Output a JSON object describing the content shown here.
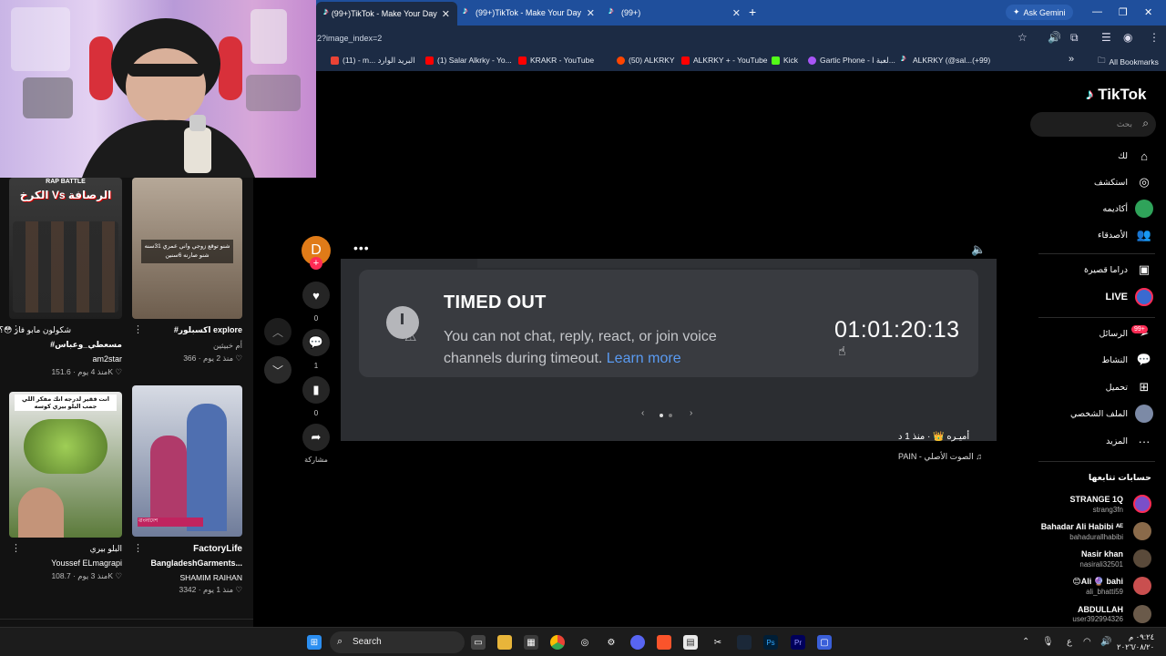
{
  "browser": {
    "tabs": [
      {
        "label": "(99+)TikTok - Make Your Day"
      },
      {
        "label": "(99+)TikTok - Make Your Day"
      },
      {
        "label": "(99+)"
      }
    ],
    "new_tab": "+",
    "ask_gemini": "Ask Gemini",
    "url": "2?image_index=2",
    "bookmarks": [
      {
        "label": "(11) - m... البريد الوارد",
        "color": "#ea4335"
      },
      {
        "label": "(1) Salar Alkrky - Yo...",
        "color": "#ff0000"
      },
      {
        "label": "KRAKR - YouTube",
        "color": "#ff0000"
      },
      {
        "label": "(50) ALKRKY",
        "color": "#ff4500"
      },
      {
        "label": "ALKRKY + - YouTube",
        "color": "#ff0000"
      },
      {
        "label": "Kick",
        "color": "#53fc18"
      },
      {
        "label": "Gartic Phone - لعبة ا...",
        "color": "#a855f7"
      },
      {
        "label": "ALKRKY (@sal...(+99)",
        "color": "#000000"
      }
    ],
    "all_bookmarks": "All Bookmarks"
  },
  "feed": {
    "items": [
      {
        "overlay": "RAP BATTLE",
        "overlay2": "الكرخ Vs الرصافة",
        "caption": "شكولون مابو فاز 😳؟",
        "caption2": "#مسعطي_وعباس",
        "author": "am2star",
        "meta": "منذ 4 يوم · 151.6K ♡"
      },
      {
        "overlay": "شنو توقع زوجي واني عمري 31سنه شنو صارنه 6سنين",
        "caption": "#اكسبلور explore",
        "author": "أم خبيثين",
        "meta": "منذ 2 يوم · 366 ♡"
      },
      {
        "overlay": "انت فقير لدرجه انك مفكر اللي جمب البلو بيري كوسه",
        "caption": "البلو بيري",
        "author": "Youssef ELmagrapi",
        "meta": "منذ 3 يوم · 108.7K ♡"
      },
      {
        "overlay": "বাংলাদেশ",
        "caption": "FactoryLife",
        "caption2": "BangladeshGarments...",
        "author": "SHAMIM RAIHAN",
        "meta": "منذ 1 يوم · 3342 ♡"
      }
    ]
  },
  "player": {
    "avatar_letter": "D",
    "like_count": "0",
    "comment_count": "1",
    "save_count": "0",
    "share_label": "مشاركة",
    "timeout_title": "TIMED OUT",
    "timeout_body": "You can not chat, reply, react, or join voice channels during timeout.",
    "learn_more": "Learn more",
    "timer": "01:01:20:13",
    "author_line": "أميـره 👑 · منذ 1 د",
    "music_line": "PAIN - الصوت الأصلي ♫"
  },
  "sidebar": {
    "logo": "TikTok",
    "search_placeholder": "بحث",
    "nav": [
      {
        "label": "لك",
        "icon": "home-icon"
      },
      {
        "label": "استكشف",
        "icon": "compass-icon"
      },
      {
        "label": "أكاديمه",
        "icon": "avatar-icon"
      },
      {
        "label": "الأصدقاء",
        "icon": "friends-icon"
      },
      {
        "label": "دراما قصيرة",
        "icon": "drama-icon"
      },
      {
        "label": "LIVE",
        "icon": "live-icon"
      },
      {
        "label": "الرسائل",
        "icon": "messages-icon",
        "badge": "99+"
      },
      {
        "label": "النشاط",
        "icon": "activity-icon"
      },
      {
        "label": "تحميل",
        "icon": "upload-icon"
      },
      {
        "label": "الملف الشخصي",
        "icon": "profile-icon"
      },
      {
        "label": "المزيد",
        "icon": "more-icon"
      }
    ],
    "following_title": "حسابات تتابعها",
    "accounts": [
      {
        "name": "STRANGE 1Q",
        "id": "strang3fn",
        "color": "#7a4fc9"
      },
      {
        "name": "Bahadar Ali Habibi ᴬᴱ",
        "id": "bahadurallhabibi",
        "color": "#8a6a4a"
      },
      {
        "name": "Nasir khan",
        "id": "nasirali32501",
        "color": "#5a4a3a"
      },
      {
        "name": "😊Ali 🔮 bahi",
        "id": "ali_bhatti59",
        "color": "#c94f4f"
      },
      {
        "name": "ABDULLAH",
        "id": "user392994326",
        "color": "#6a5a4a"
      }
    ]
  },
  "taskbar": {
    "search_label": "Search",
    "time": "٠٩:٢٤ م",
    "date": "٢٠٢٦/٠٨/٢٠",
    "lang": "ع"
  }
}
